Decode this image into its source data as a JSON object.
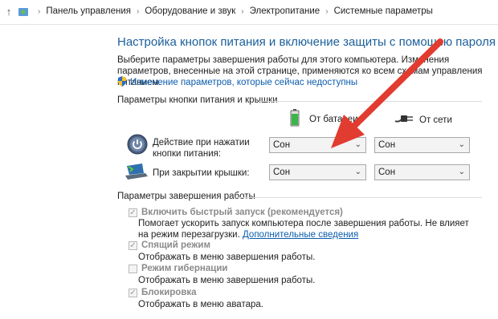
{
  "breadcrumb": {
    "items": [
      "Панель управления",
      "Оборудование и звук",
      "Электропитание",
      "Системные параметры"
    ]
  },
  "page": {
    "title": "Настройка кнопок питания и включение защиты с помощью пароля",
    "intro": "Выберите параметры завершения работы для этого компьютера. Изменения параметров, внесенные на этой странице, применяются ко всем схемам управления питанием.",
    "admin_link": "Изменение параметров, которые сейчас недоступны"
  },
  "power_buttons": {
    "section_title": "Параметры кнопки питания и крышки",
    "col_battery": "От батареи",
    "col_ac": "От сети",
    "rows": [
      {
        "label": "Действие при нажатии кнопки питания:",
        "battery": "Сон",
        "ac": "Сон"
      },
      {
        "label": "При закрытии крышки:",
        "battery": "Сон",
        "ac": "Сон"
      }
    ]
  },
  "shutdown": {
    "section_title": "Параметры завершения работы",
    "options": [
      {
        "label": "Включить быстрый запуск (рекомендуется)",
        "checked": true,
        "desc": "Помогает ускорить запуск компьютера после завершения работы. Не влияет на режим перезагрузки.",
        "link": "Дополнительные сведения"
      },
      {
        "label": "Спящий режим",
        "checked": true,
        "desc": "Отображать в меню завершения работы."
      },
      {
        "label": "Режим гибернации",
        "checked": false,
        "desc": "Отображать в меню завершения работы."
      },
      {
        "label": "Блокировка",
        "checked": true,
        "desc": "Отображать в меню аватара."
      }
    ]
  },
  "colors": {
    "title": "#1b5f9a",
    "link": "#0b5cad",
    "arrow": "#e23b30"
  }
}
